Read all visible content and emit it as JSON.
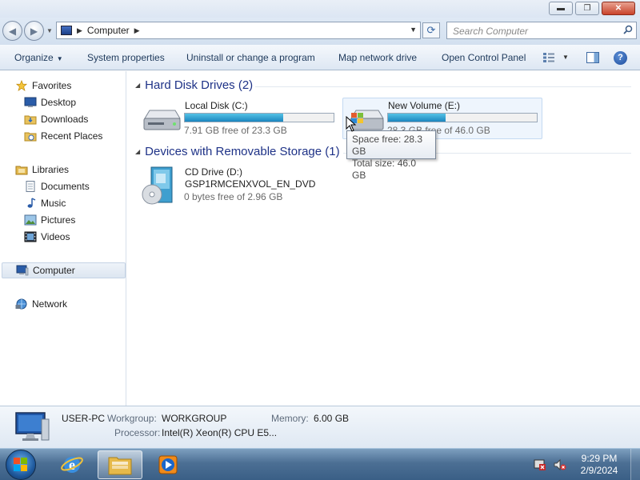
{
  "window": {
    "title_buttons": {
      "minimize": "▬",
      "maximize": "❐",
      "close": "✕"
    }
  },
  "address": {
    "location": "Computer",
    "search_placeholder": "Search Computer"
  },
  "toolbar": {
    "organize": "Organize",
    "system_properties": "System properties",
    "uninstall": "Uninstall or change a program",
    "map_drive": "Map network drive",
    "control_panel": "Open Control Panel",
    "help": "?"
  },
  "nav": {
    "favorites": "Favorites",
    "desktop": "Desktop",
    "downloads": "Downloads",
    "recent_places": "Recent Places",
    "libraries": "Libraries",
    "documents": "Documents",
    "music": "Music",
    "pictures": "Pictures",
    "videos": "Videos",
    "computer": "Computer",
    "network": "Network"
  },
  "content": {
    "hdd_header": "Hard Disk Drives (2)",
    "removable_header": "Devices with Removable Storage (1)",
    "drives": [
      {
        "name": "Local Disk (C:)",
        "free": "7.91 GB free of 23.3 GB",
        "used_fraction": 0.66
      },
      {
        "name": "New Volume (E:)",
        "free": "28.3 GB free of 46.0 GB",
        "used_fraction": 0.385
      }
    ],
    "cd": {
      "name": "CD Drive (D:)",
      "label": "GSP1RMCENXVOL_EN_DVD",
      "free": "0 bytes free of 2.96 GB"
    },
    "tooltip": {
      "line1": "Space free: 28.3 GB",
      "line2": "Total size: 46.0 GB"
    }
  },
  "details": {
    "computer_name": "USER-PC",
    "workgroup_key": "Workgroup:",
    "workgroup_val": "WORKGROUP",
    "memory_key": "Memory:",
    "memory_val": "6.00 GB",
    "processor_key": "Processor:",
    "processor_val": "Intel(R) Xeon(R) CPU E5..."
  },
  "taskbar": {
    "time": "9:29 PM",
    "date": "2/9/2024"
  },
  "colors": {
    "accent": "#1e3287",
    "bar_fill": "#1b86bf"
  }
}
